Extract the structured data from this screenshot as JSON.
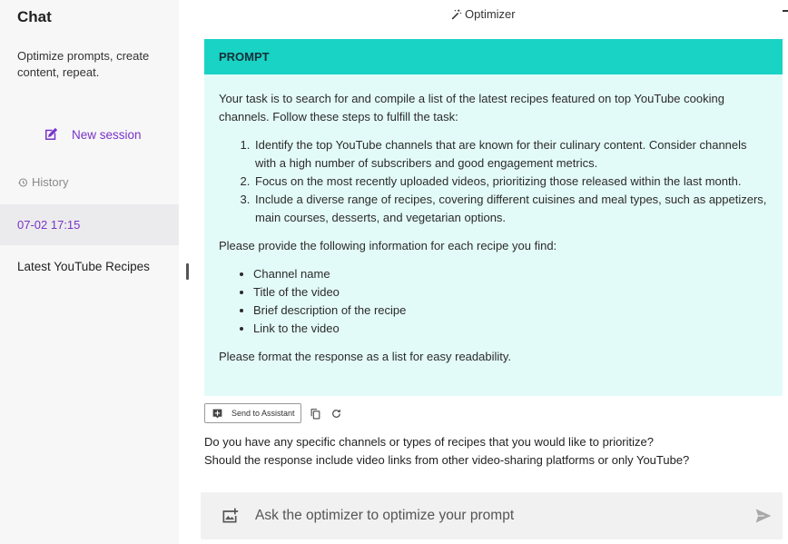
{
  "sidebar": {
    "title": "Chat",
    "tagline": "Optimize prompts, create content, repeat.",
    "new_session_label": "New session",
    "history_label": "History",
    "session_date": "07-02 17:15",
    "session_title": "Latest YouTube Recipes"
  },
  "header": {
    "title": "Optimizer"
  },
  "prompt": {
    "heading": "PROMPT",
    "intro": "Your task is to search for and compile a list of the latest recipes featured on top YouTube cooking channels. Follow these steps to fulfill the task:",
    "steps": [
      "Identify the top YouTube channels that are known for their culinary content. Consider channels with a high number of subscribers and good engagement metrics.",
      "Focus on the most recently uploaded videos, prioritizing those released within the last month.",
      "Include a diverse range of recipes, covering different cuisines and meal types, such as appetizers, main courses, desserts, and vegetarian options."
    ],
    "info_intro": "Please provide the following information for each recipe you find:",
    "info_items": [
      "Channel name",
      "Title of the video",
      "Brief description of the recipe",
      "Link to the video"
    ],
    "closing": "Please format the response as a list for easy readability."
  },
  "actions": {
    "send_label": "Send to Assistant"
  },
  "followup": {
    "line1": "Do you have any specific channels or types of recipes that you would like to prioritize?",
    "line2": "Should the response include video links from other video-sharing platforms or only YouTube?"
  },
  "input": {
    "placeholder": "Ask the optimizer to optimize your prompt",
    "value": ""
  },
  "colors": {
    "accent_purple": "#7a33c8",
    "prompt_header": "#19d3c4",
    "prompt_body": "#e3fbf8",
    "sidebar_bg": "#f7f7f8"
  },
  "icons": {
    "new_session": "edit-square-icon",
    "history": "clock-history-icon",
    "optimizer": "magic-wand-icon",
    "send_to_assistant": "assistant-plus-icon",
    "copy": "copy-icon",
    "refresh": "refresh-icon",
    "add_image": "add-image-icon",
    "send": "send-icon"
  }
}
